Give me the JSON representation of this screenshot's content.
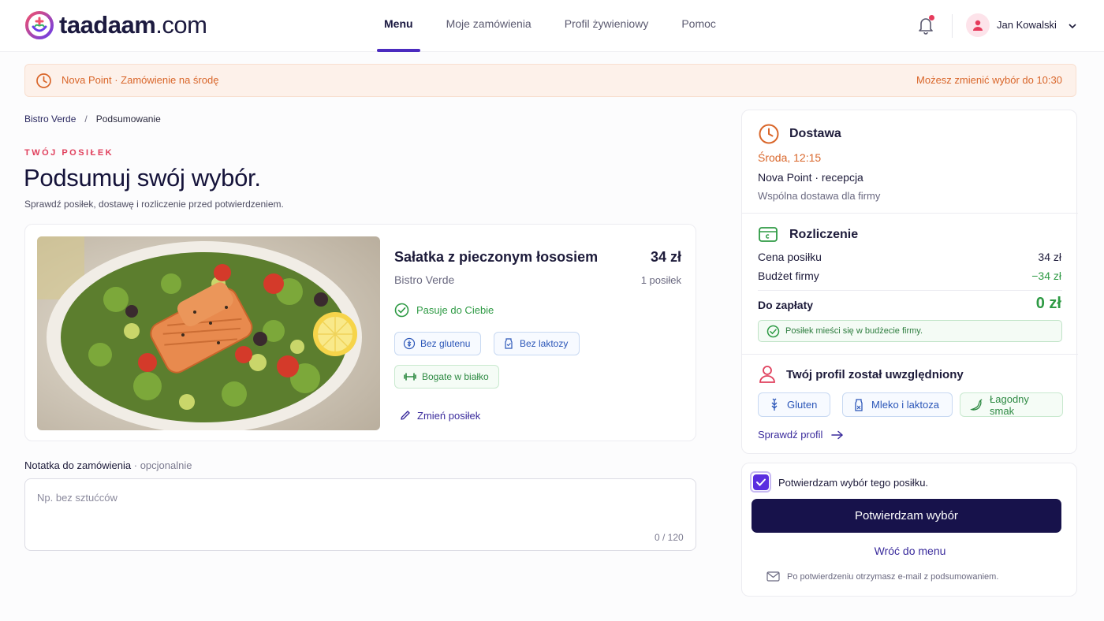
{
  "brand": {
    "name": "taadaam",
    "domain": ".com"
  },
  "nav": [
    {
      "label": "Menu",
      "active": true
    },
    {
      "label": "Moje zamówienia",
      "active": false
    },
    {
      "label": "Profil żywieniowy",
      "active": false
    },
    {
      "label": "Pomoc",
      "active": false
    }
  ],
  "user": {
    "name": "Jan Kowalski"
  },
  "banner": {
    "left": "Nova Point · Zamówienie na środę",
    "right": "Możesz zmienić wybór do 10:30"
  },
  "breadcrumb": {
    "parent": "Bistro Verde",
    "separator": "/",
    "current": "Podsumowanie"
  },
  "page": {
    "kicker": "TWÓJ POSIŁEK",
    "title": "Podsumuj swój wybór.",
    "subtitle": "Sprawdź posiłek, dostawę i rozliczenie przed potwierdzeniem."
  },
  "meal": {
    "name": "Sałatka z pieczonym łososiem",
    "price": "34 zł",
    "restaurant": "Bistro Verde",
    "quantity": "1 posiłek",
    "fit_label": "Pasuje do Ciebie",
    "tags": [
      "Bez glutenu",
      "Bez laktozy",
      "Bogate w białko"
    ],
    "change_label": "Zmień posiłek"
  },
  "note": {
    "label": "Notatka do zamówienia",
    "optional": " · opcjonalnie",
    "placeholder": "Np. bez sztućców",
    "counter": "0 / 120"
  },
  "delivery": {
    "title": "Dostawa",
    "time": "Środa, 12:15",
    "place": "Nova Point · recepcja",
    "info": "Wspólna dostawa dla firmy"
  },
  "billing": {
    "title": "Rozliczenie",
    "rows": [
      {
        "label": "Cena posiłku",
        "value": "34 zł"
      },
      {
        "label": "Budżet firmy",
        "value": "−34 zł"
      }
    ],
    "total_label": "Do zapłaty",
    "total_value": "0 zł",
    "ok_message": "Posiłek mieści się w budżecie firmy."
  },
  "profile": {
    "title": "Twój profil został uwzględniony",
    "chips": [
      "Gluten",
      "Mleko i laktoza",
      "Łagodny smak"
    ],
    "link": "Sprawdź profil"
  },
  "confirm": {
    "checkbox_label": "Potwierdzam wybór tego posiłku.",
    "checked": true,
    "button": "Potwierdzam wybór",
    "back": "Wróć do menu",
    "email_note": "Po potwierdzeniu otrzymasz e-mail z podsumowaniem."
  },
  "colors": {
    "accent": "#4b2bbf",
    "primary_button": "#17124b",
    "warning": "#d9662a",
    "success": "#2e9a44",
    "alert": "#e0405d"
  }
}
